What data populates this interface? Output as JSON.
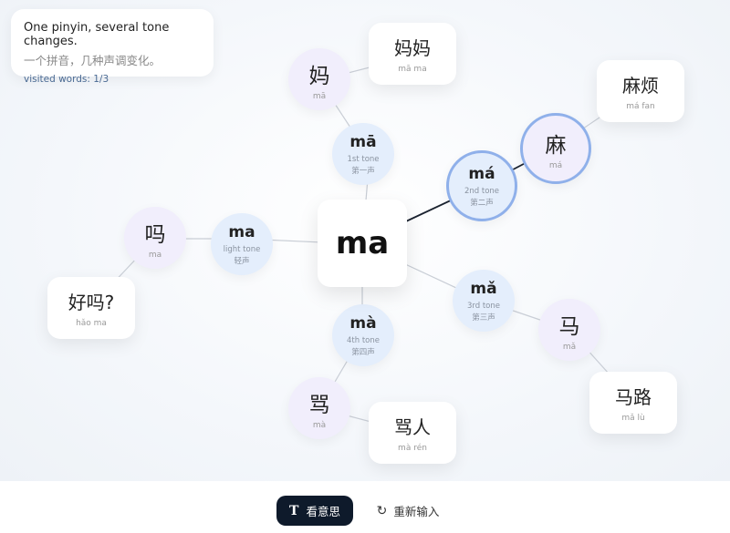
{
  "info": {
    "line1": "One pinyin, several tone changes.",
    "line2": "一个拼音，几种声调变化。",
    "visited": "visited words: 1/3"
  },
  "center": "ma",
  "tones": {
    "t1": {
      "syllable": "mā",
      "en": "1st tone",
      "zh": "第一声"
    },
    "t2": {
      "syllable": "má",
      "en": "2nd tone",
      "zh": "第二声"
    },
    "t3": {
      "syllable": "mǎ",
      "en": "3rd tone",
      "zh": "第三声"
    },
    "t4": {
      "syllable": "mà",
      "en": "4th tone",
      "zh": "第四声"
    },
    "t0": {
      "syllable": "ma",
      "en": "light tone",
      "zh": "轻声"
    }
  },
  "chars": {
    "c1": {
      "han": "妈",
      "py": "mā"
    },
    "c2": {
      "han": "麻",
      "py": "má"
    },
    "c3": {
      "han": "马",
      "py": "mǎ"
    },
    "c4": {
      "han": "骂",
      "py": "mà"
    },
    "c0": {
      "han": "吗",
      "py": "ma"
    }
  },
  "words": {
    "w1": {
      "han": "妈妈",
      "py": "mā ma"
    },
    "w2": {
      "han": "麻烦",
      "py": "má fan"
    },
    "w3": {
      "han": "马路",
      "py": "mǎ lù"
    },
    "w4": {
      "han": "骂人",
      "py": "mà rén"
    },
    "w0": {
      "han": "好吗?",
      "py": "hǎo ma"
    }
  },
  "buttons": {
    "meaning_icon": "T",
    "meaning": "看意思",
    "reset": "重新输入",
    "reset_icon": "↻"
  },
  "colors": {
    "selected_border": "#8fb0ea",
    "char_bg": "#f1eefc",
    "tone_bg": "#e4eefc",
    "button_dark": "#0e1a2b"
  }
}
